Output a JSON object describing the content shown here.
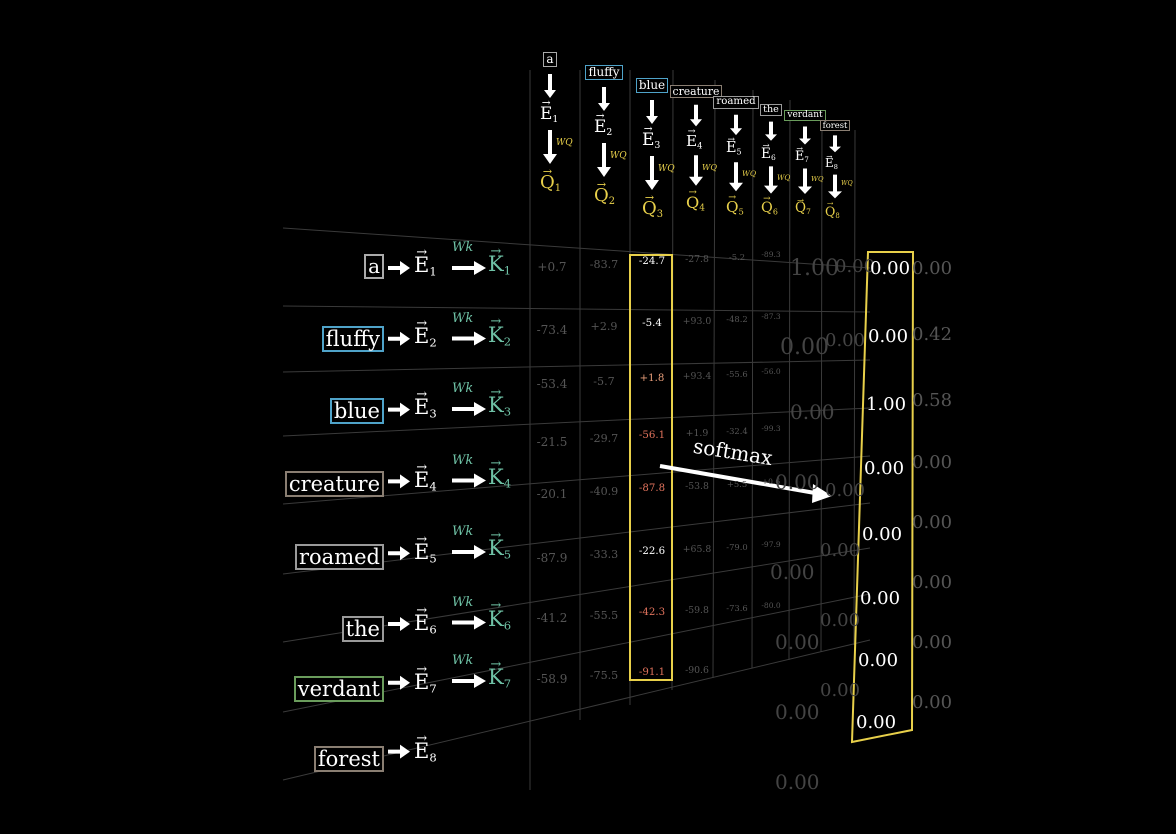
{
  "tokens": [
    "a",
    "fluffy",
    "blue",
    "creature",
    "roamed",
    "the",
    "verdant",
    "forest"
  ],
  "token_colors": [
    "#aaaaaa",
    "#4fa3c9",
    "#4fa3c9",
    "#8a7e72",
    "#9a9a9a",
    "#9a9a9a",
    "#6a9c5c",
    "#8a7e72"
  ],
  "embed_letter": "E",
  "query_letter": "Q",
  "key_letter": "K",
  "wq_label": "WQ",
  "wk_label": "Wk",
  "indices": [
    "1",
    "2",
    "3",
    "4",
    "5",
    "6",
    "7",
    "8"
  ],
  "grid_values": [
    [
      "+0.7",
      "-83.7",
      "-24.7",
      "-27.8",
      "-5.2",
      "-89.3"
    ],
    [
      "-73.4",
      "+2.9",
      "-5.4",
      "+93.0",
      "-48.2",
      "-87.3"
    ],
    [
      "-53.4",
      "-5.7",
      "+1.8",
      "+93.4",
      "-55.6",
      "-56.0"
    ],
    [
      "-21.5",
      "-29.7",
      "-56.1",
      "+1.9",
      "-32.4",
      "-99.3"
    ],
    [
      "-20.1",
      "-40.9",
      "-87.8",
      "-53.8",
      "+5.5",
      "+0.6"
    ],
    [
      "-87.9",
      "-33.3",
      "-22.6",
      "+65.8",
      "-79.0",
      "-97.9"
    ],
    [
      "-41.2",
      "-55.5",
      "-42.3",
      "-59.8",
      "-73.6",
      "-80.0"
    ],
    [
      "-58.9",
      "-75.5",
      "-91.1",
      "-90.6",
      "",
      ""
    ]
  ],
  "highlight_column": [
    "-24.7",
    "-5.4",
    "+1.8",
    "-56.1",
    "-87.8",
    "-22.6",
    "-42.3",
    "-91.1"
  ],
  "softmax_label": "softmax",
  "softmax_result": [
    "0.00",
    "0.00",
    "1.00",
    "0.00",
    "0.00",
    "0.00",
    "0.00",
    "0.00"
  ],
  "ghost_right": [
    "0.00",
    "0.42",
    "0.58",
    "0.00",
    "0.00",
    "0.00",
    "0.00",
    "0.00"
  ],
  "ghost_left": [
    "1.00",
    "0.00",
    "0.00",
    "0.00",
    "0.00",
    "0.00",
    "0.00",
    "0.00",
    "0.00",
    "0.00",
    "0.00",
    "0.00",
    "0.00",
    "0.00"
  ],
  "ghost_mid": [
    "0.00",
    "1.00",
    "0.00",
    "0.00",
    "0.00",
    "0.00",
    "0.00",
    "0.00"
  ]
}
